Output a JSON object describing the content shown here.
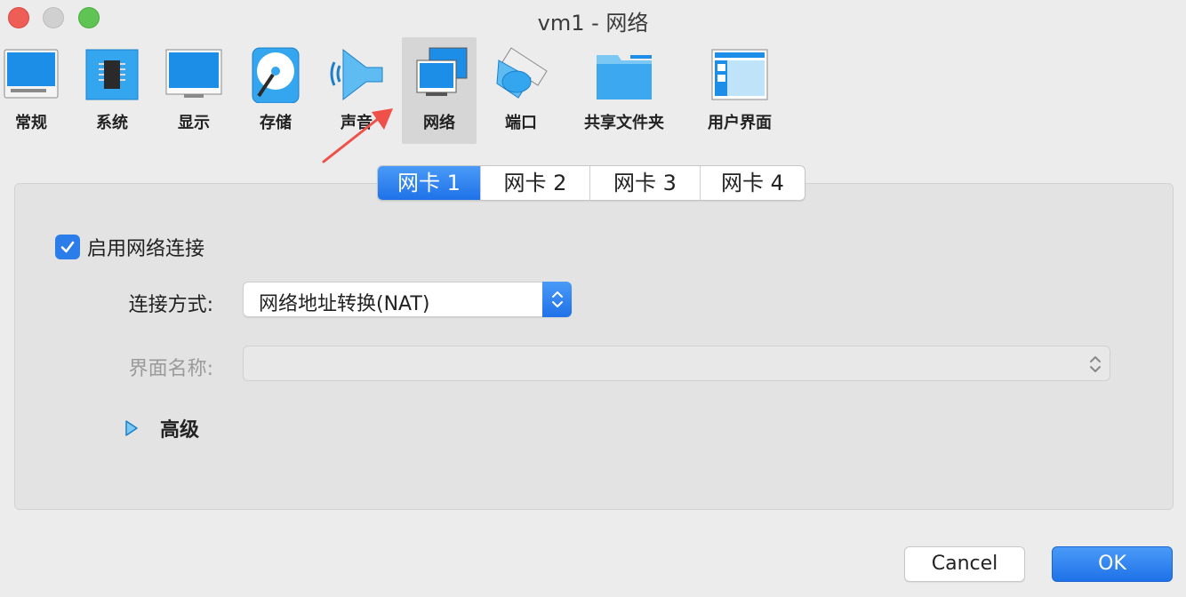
{
  "window": {
    "title": "vm1 - 网络"
  },
  "toolbar": {
    "items": [
      {
        "label": "常规",
        "icon": "monitor-general-icon"
      },
      {
        "label": "系统",
        "icon": "chip-icon"
      },
      {
        "label": "显示",
        "icon": "display-icon"
      },
      {
        "label": "存储",
        "icon": "storage-disk-icon"
      },
      {
        "label": "声音",
        "icon": "speaker-icon"
      },
      {
        "label": "网络",
        "icon": "network-icon",
        "selected": true
      },
      {
        "label": "端口",
        "icon": "serial-port-icon"
      },
      {
        "label": "共享文件夹",
        "icon": "folder-icon"
      },
      {
        "label": "用户界面",
        "icon": "user-interface-icon"
      }
    ]
  },
  "tabs": [
    {
      "label": "网卡 1",
      "active": true
    },
    {
      "label": "网卡 2"
    },
    {
      "label": "网卡 3"
    },
    {
      "label": "网卡 4"
    }
  ],
  "adapter": {
    "enable_label": "启用网络连接",
    "enabled": true,
    "attach_label": "连接方式:",
    "attach_value": "网络地址转换(NAT)",
    "name_label": "界面名称:",
    "name_value": "",
    "advanced_label": "高级"
  },
  "buttons": {
    "cancel": "Cancel",
    "ok": "OK"
  },
  "colors": {
    "accent": "#2b7de9",
    "annotation_arrow": "#f0504a"
  }
}
